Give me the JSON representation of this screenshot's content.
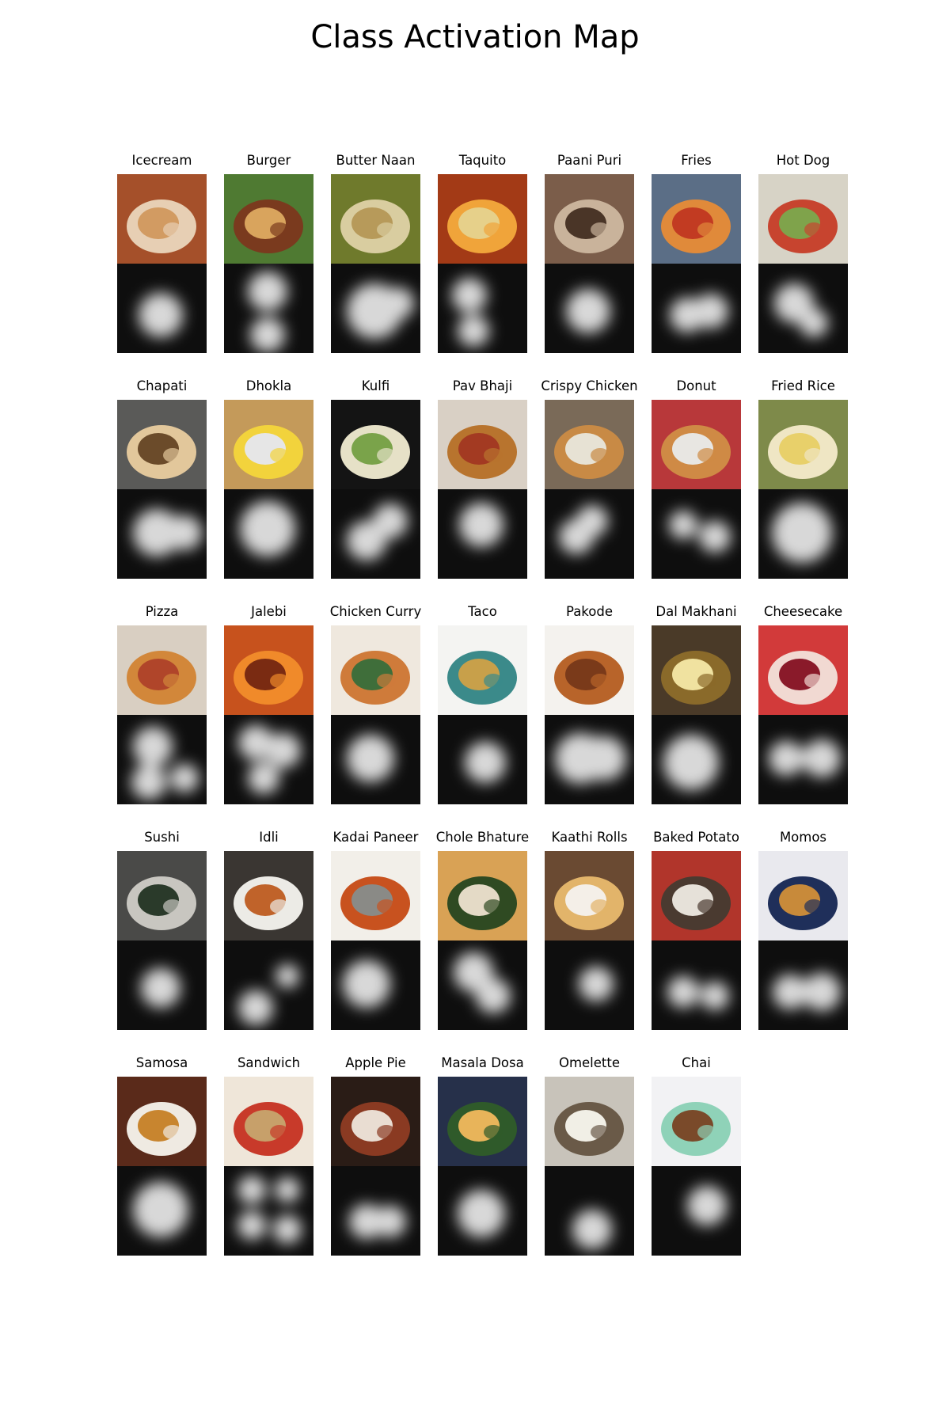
{
  "title": "Class Activation Map",
  "panels": [
    {
      "label": "Icecream",
      "palette": [
        "#a5502a",
        "#e7cfb4",
        "#d29b62"
      ],
      "icon": "icecream-cup"
    },
    {
      "label": "Burger",
      "palette": [
        "#4f7a32",
        "#7a3a1e",
        "#d9a45d"
      ],
      "icon": "burger"
    },
    {
      "label": "Butter Naan",
      "palette": [
        "#6f7a2c",
        "#d9cda0",
        "#b79a5a"
      ],
      "icon": "naan"
    },
    {
      "label": "Taquito",
      "palette": [
        "#a33a16",
        "#f0a43a",
        "#e6d08a"
      ],
      "icon": "taquito-platter"
    },
    {
      "label": "Paani Puri",
      "palette": [
        "#7b5d4a",
        "#c9b39b",
        "#4a3527"
      ],
      "icon": "paani-puri-bowl"
    },
    {
      "label": "Fries",
      "palette": [
        "#5b6e86",
        "#e08a3a",
        "#c23b22"
      ],
      "icon": "fries-dish"
    },
    {
      "label": "Hot Dog",
      "palette": [
        "#d7d3c6",
        "#c7442f",
        "#7fa34b"
      ],
      "icon": "hot-dogs"
    },
    {
      "label": "Chapati",
      "palette": [
        "#5a5a58",
        "#e2c79b",
        "#6b4b2a"
      ],
      "icon": "chapati-stack"
    },
    {
      "label": "Dhokla",
      "palette": [
        "#c49a5a",
        "#f2d33c",
        "#e6e6e6"
      ],
      "icon": "dhokla"
    },
    {
      "label": "Kulfi",
      "palette": [
        "#141414",
        "#e6e1c7",
        "#7aa34a"
      ],
      "icon": "kulfi-sticks"
    },
    {
      "label": "Pav Bhaji",
      "palette": [
        "#d9d0c5",
        "#b8742e",
        "#a33a22"
      ],
      "icon": "pav-bhaji-plate"
    },
    {
      "label": "Crispy Chicken",
      "palette": [
        "#7a6a58",
        "#c88a45",
        "#e7e2d4"
      ],
      "icon": "chicken-burger"
    },
    {
      "label": "Donut",
      "palette": [
        "#b8383a",
        "#cf8a45",
        "#e8e6e2"
      ],
      "icon": "donuts"
    },
    {
      "label": "Fried Rice",
      "palette": [
        "#7e8a4a",
        "#efe6c4",
        "#e8d06a"
      ],
      "icon": "fried-rice-plate"
    },
    {
      "label": "Pizza",
      "palette": [
        "#d9cfc2",
        "#d2873a",
        "#b0452a"
      ],
      "icon": "pizza"
    },
    {
      "label": "Jalebi",
      "palette": [
        "#c7521d",
        "#f08a2a",
        "#7a2b12"
      ],
      "icon": "jalebi"
    },
    {
      "label": "Chicken Curry",
      "palette": [
        "#efe8de",
        "#cf7b3a",
        "#3f6e3a"
      ],
      "icon": "curry-bowl"
    },
    {
      "label": "Taco",
      "palette": [
        "#f4f4f2",
        "#3b8a8a",
        "#c8a04a"
      ],
      "icon": "taco-illustration"
    },
    {
      "label": "Pakode",
      "palette": [
        "#f4f2ee",
        "#b8642a",
        "#7a3a1a"
      ],
      "icon": "pakode"
    },
    {
      "label": "Dal Makhani",
      "palette": [
        "#4a3a28",
        "#8a6a2a",
        "#f0e2a0"
      ],
      "icon": "dal-pot"
    },
    {
      "label": "Cheesecake",
      "palette": [
        "#d23a3a",
        "#f1d9d2",
        "#8a1a2a"
      ],
      "icon": "cheesecake"
    },
    {
      "label": "Sushi",
      "palette": [
        "#4a4a48",
        "#c8c6c0",
        "#2a3a2a"
      ],
      "icon": "sushi-tray"
    },
    {
      "label": "Idli",
      "palette": [
        "#3a3632",
        "#ecebe6",
        "#c0632a"
      ],
      "icon": "idli-plate"
    },
    {
      "label": "Kadai Paneer",
      "palette": [
        "#f2efe9",
        "#c8521f",
        "#8a8a86"
      ],
      "icon": "kadai-paneer"
    },
    {
      "label": "Chole Bhature",
      "palette": [
        "#d9a255",
        "#2f4a22",
        "#e4dac6"
      ],
      "icon": "chole-bhature"
    },
    {
      "label": "Kaathi Rolls",
      "palette": [
        "#6a4a32",
        "#e2b46a",
        "#f4efe8"
      ],
      "icon": "kathi-roll"
    },
    {
      "label": "Baked Potato",
      "palette": [
        "#b1352b",
        "#4a3a30",
        "#e6e1d9"
      ],
      "icon": "baked-potato"
    },
    {
      "label": "Momos",
      "palette": [
        "#e9e9ee",
        "#1f2f5a",
        "#c88a3a"
      ],
      "icon": "momos-plate"
    },
    {
      "label": "Samosa",
      "palette": [
        "#5a2a1a",
        "#efeae2",
        "#c8852f"
      ],
      "icon": "samosa-plate"
    },
    {
      "label": "Sandwich",
      "palette": [
        "#efe6d9",
        "#c83a2a",
        "#c7a06a"
      ],
      "icon": "sandwich-grid"
    },
    {
      "label": "Apple Pie",
      "palette": [
        "#2a1c16",
        "#8a3a22",
        "#e9ddd2"
      ],
      "icon": "apple-pie"
    },
    {
      "label": "Masala Dosa",
      "palette": [
        "#26304a",
        "#2f5a2a",
        "#e8b45a"
      ],
      "icon": "masala-dosa"
    },
    {
      "label": "Omelette",
      "palette": [
        "#c8c3ba",
        "#6a5a48",
        "#f1efe6"
      ],
      "icon": "omelette-plate"
    },
    {
      "label": "Chai",
      "palette": [
        "#f2f2f4",
        "#8fd2b8",
        "#7a4a2a"
      ],
      "icon": "chai-cup"
    }
  ]
}
